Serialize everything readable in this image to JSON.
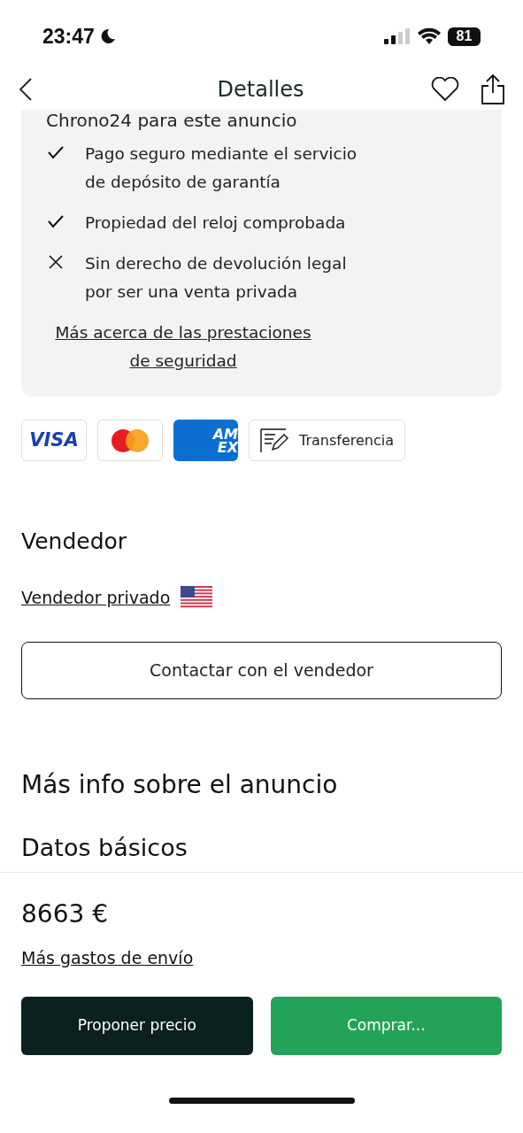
{
  "status_bar": {
    "time": "23:47",
    "battery": "81"
  },
  "header": {
    "title": "Detalles"
  },
  "security": {
    "title": "Chrono24 para este anuncio",
    "features": [
      {
        "kind": "check",
        "text": "Pago seguro mediante el servicio de depósito de garantía"
      },
      {
        "kind": "check",
        "text": "Propiedad del reloj comprobada"
      },
      {
        "kind": "cross",
        "text": "Sin derecho de devolución legal por ser una venta privada"
      }
    ],
    "link": "Más acerca de las prestaciones de seguridad"
  },
  "payment_methods": [
    {
      "kind": "visa",
      "label": "VISA"
    },
    {
      "kind": "mastercard"
    },
    {
      "kind": "amex",
      "lines": [
        "AM",
        "EX"
      ]
    },
    {
      "kind": "transfer",
      "label": "Transferencia"
    }
  ],
  "seller": {
    "heading": "Vendedor",
    "name": "Vendedor privado",
    "contact_button": "Contactar con el vendedor"
  },
  "more_info": {
    "heading": "Más info sobre el anuncio",
    "subheading": "Datos básicos"
  },
  "footer": {
    "price": "8663 €",
    "shipping_link": "Más gastos de envío",
    "buttons": [
      {
        "kind": "secondary",
        "label": "Proponer precio"
      },
      {
        "kind": "primary",
        "label": "Comprar..."
      }
    ]
  }
}
